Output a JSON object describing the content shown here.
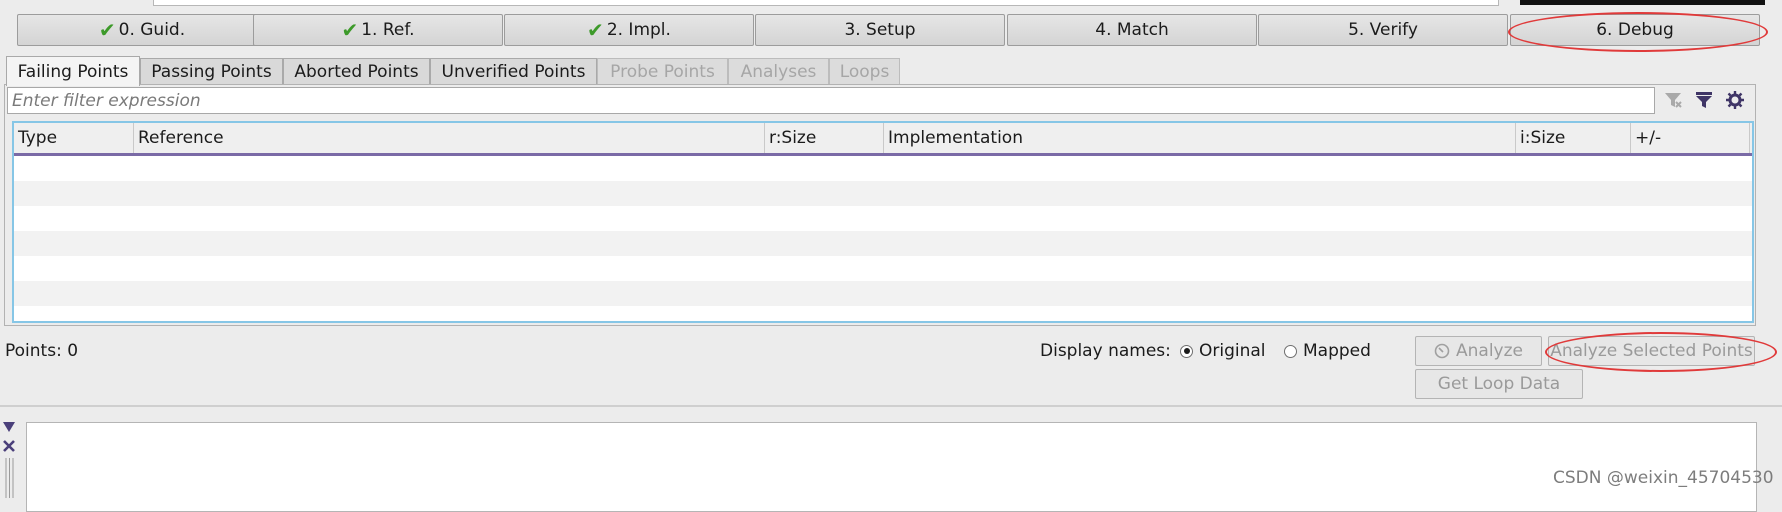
{
  "steps": [
    {
      "label": "0. Guid.",
      "done": true
    },
    {
      "label": "1. Ref.",
      "done": true
    },
    {
      "label": "2. Impl.",
      "done": true
    },
    {
      "label": "3. Setup",
      "done": false
    },
    {
      "label": "4. Match",
      "done": false
    },
    {
      "label": "5. Verify",
      "done": false
    },
    {
      "label": "6. Debug",
      "done": false
    }
  ],
  "check_glyph": "✔",
  "tabs": [
    {
      "label": "Failing Points",
      "state": "active"
    },
    {
      "label": "Passing Points",
      "state": "enabled"
    },
    {
      "label": "Aborted Points",
      "state": "enabled"
    },
    {
      "label": "Unverified Points",
      "state": "enabled"
    },
    {
      "label": "Probe Points",
      "state": "disabled"
    },
    {
      "label": "Analyses",
      "state": "disabled"
    },
    {
      "label": "Loops",
      "state": "disabled"
    }
  ],
  "filter": {
    "placeholder": "Enter filter expression",
    "value": ""
  },
  "filter_icons": [
    "clear-filter-icon",
    "apply-filter-icon",
    "filter-settings-icon"
  ],
  "table": {
    "columns": [
      "Type",
      "Reference",
      "r:Size",
      "Implementation",
      "i:Size",
      "+/-"
    ],
    "rows": []
  },
  "footer": {
    "points_label": "Points: 0",
    "display_names_label": "Display names:",
    "options": [
      {
        "label": "Original",
        "selected": true
      },
      {
        "label": "Mapped",
        "selected": false
      }
    ],
    "analyze_label": "Analyze",
    "analyze_selected_label": "Analyze Selected Points",
    "get_loop_data_label": "Get Loop Data"
  },
  "watermark": "CSDN @weixin_45704530",
  "colors": {
    "annotation": "#e03a3a",
    "check": "#3d9a2a",
    "header_underline": "#7a6aa6",
    "table_focus": "#86c6e6"
  }
}
